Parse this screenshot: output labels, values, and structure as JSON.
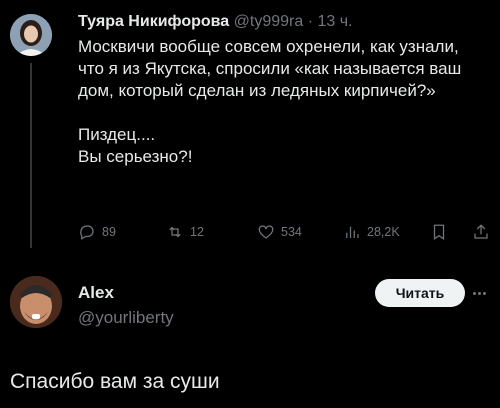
{
  "tweet": {
    "author_name": "Туяра Никифорова",
    "handle": "@ty999ra",
    "separator": "·",
    "time": "13 ч.",
    "text_paragraphs": [
      "Москвичи вообще совсем охренели, как узнали, что я из Якутска, спросили «как называется ваш дом, который сделан из ледяных кирпичей?»",
      "Пиздец....",
      "Вы серьезно?!"
    ],
    "stats": {
      "replies": "89",
      "reposts": "12",
      "likes": "534",
      "views": "28,2K"
    }
  },
  "reply": {
    "author_name": "Alex",
    "handle": "@yourliberty",
    "follow_label": "Читать",
    "text": "Спасибо вам за суши"
  },
  "icons": {
    "reply": "reply-icon",
    "repost": "repost-icon",
    "like": "heart-icon",
    "views": "views-icon",
    "bookmark": "bookmark-icon",
    "share": "share-icon",
    "more": "more-icon"
  },
  "colors": {
    "background": "#000000",
    "text": "#e7e9ea",
    "muted": "#71767b",
    "button_bg": "#eff3f4"
  }
}
